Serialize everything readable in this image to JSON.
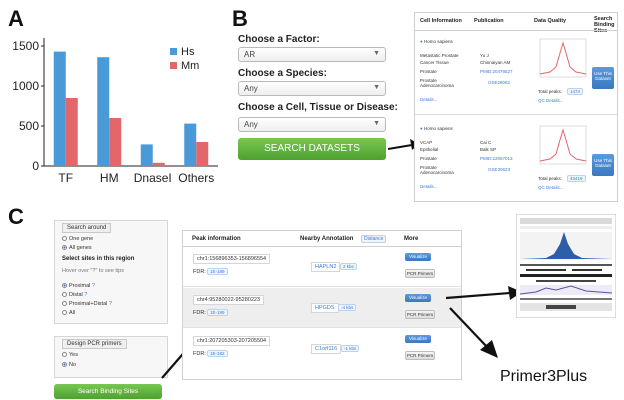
{
  "panels": {
    "a": "A",
    "b": "B",
    "c": "C"
  },
  "colors": {
    "hs": "#4a9ad8",
    "mm": "#e2676b",
    "green": "#5bb33b",
    "blue": "#3a78c0"
  },
  "chart_data": {
    "type": "bar",
    "categories": [
      "TF",
      "HM",
      "DnaseI",
      "Others"
    ],
    "series": [
      {
        "name": "Hs",
        "values": [
          1430,
          1360,
          270,
          530
        ]
      },
      {
        "name": "Mm",
        "values": [
          850,
          600,
          40,
          300
        ]
      }
    ],
    "yticks": [
      "0",
      "500",
      "1000",
      "1500"
    ],
    "ylim": [
      0,
      1600
    ],
    "legend_position": "top-right",
    "title": "",
    "xlabel": "",
    "ylabel": ""
  },
  "search_form": {
    "factor_label": "Choose a Factor:",
    "factor_value": "AR",
    "species_label": "Choose a Species:",
    "species_value": "Any",
    "cell_label": "Choose a Cell, Tissue or Disease:",
    "cell_value": "Any",
    "search_button": "SEARCH DATASETS"
  },
  "results_table": {
    "headers": [
      "Cell Information",
      "Publication",
      "Data Quality",
      "Search Binding Sites"
    ],
    "rows": [
      {
        "species": "Homo sapiens",
        "k1": "Metastatic Prostate",
        "v1": "Yu J",
        "k2": "Cancer Tissue",
        "v2": "Chinnaiyan AM",
        "k3": "Prostate",
        "v3": "PMID:20478527",
        "k4": "Prostate Adenocarcinoma",
        "v4": "GSE28062",
        "details": "Details...",
        "total_label": "Total peaks:",
        "total_value": "1474",
        "qc_link": "QC Details...",
        "button": "Use This Dataset"
      },
      {
        "species": "Homo sapiens",
        "k1": "VCAP",
        "v1": "Cai C",
        "k2": "Epithelial",
        "v2": "Balk SP",
        "k3": "Prostate",
        "v3": "PMID:22057013",
        "k4": "Prostate Adenocarcinoma",
        "v4": "GSE30623",
        "details": "Details...",
        "total_label": "Total peaks:",
        "total_value": "43419",
        "qc_link": "QC Details...",
        "button": "Use This Dataset"
      }
    ]
  },
  "region_form": {
    "search_around_title": "Search around",
    "one_gene": "One gene",
    "all_genes": "All genes",
    "select_sites": "Select sites in this region",
    "hover_hint": "Hover over \"?\" to see tips",
    "proximal": "Proximal",
    "distal": "Distal",
    "proximal_distal": "Proximal+Distal",
    "all": "All",
    "q": "?",
    "design_title": "Design PCR primers",
    "yes": "Yes",
    "no": "No",
    "search_button": "Search Binding Sites"
  },
  "peaks_table": {
    "headers": [
      "Peak information",
      "Nearby Annotation",
      "Distance",
      "More"
    ],
    "rows": [
      {
        "locus": "chr1:156896353-156896554",
        "fdr_label": "FDR:",
        "fdr": "1E-189",
        "gene": "HAPLN2",
        "distance": "2 kbs",
        "visualize": "Visualize",
        "pcr": "PCR Primers"
      },
      {
        "locus": "chr4:95280022-95280223",
        "fdr_label": "FDR:",
        "fdr": "1E-189",
        "gene": "HPGDS",
        "distance": "-4 kbs",
        "visualize": "Visualize",
        "pcr": "PCR Primers"
      },
      {
        "locus": "chr1:207205303-207205504",
        "fdr_label": "FDR:",
        "fdr": "1E-182",
        "gene": "C1orf116",
        "distance": "-1 kbs",
        "visualize": "Visualize",
        "pcr": "PCR Primers"
      }
    ]
  },
  "primer_label": "Primer3Plus"
}
